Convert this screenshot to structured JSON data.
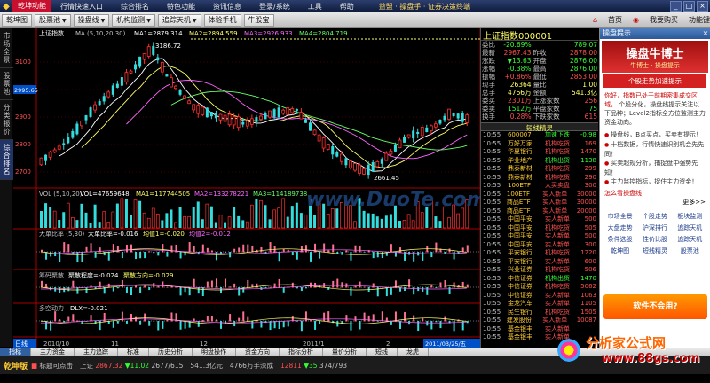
{
  "titlebar": {
    "menu": [
      "乾坤功能",
      "行情快速入口",
      "综合排名",
      "特色功能",
      "资讯信息",
      "登录/系统",
      "工具",
      "帮助"
    ],
    "center": "益盟 · 操盘手 · 证券决策终端",
    "win_buttons": [
      "_",
      "□",
      "×"
    ]
  },
  "toolbar": {
    "buttons": [
      "乾坤图",
      "股票池",
      "操盘线",
      "机构监测",
      "追踪天机",
      "体验手机",
      "牛股宝"
    ],
    "right_items": [
      "首页",
      "我要购买",
      "功能键"
    ]
  },
  "leftstrip": [
    "市场全景",
    "股票池",
    "分类报价",
    "综合排名"
  ],
  "chart": {
    "main_header": {
      "name": "上证指数",
      "ma_label": "MA (5,10,20,30)",
      "ma1": "MA1=2879.314",
      "ma2": "MA2=2894.559",
      "ma3": "MA3=2926.933",
      "ma4": "MA4=2804.719"
    },
    "price_labels": [
      "3100",
      "3000",
      "2995.65",
      "2900",
      "2800",
      "2700"
    ],
    "high_label": "3186.72",
    "low_label": "2661.45",
    "vol_header": {
      "name": "VOL (5,10,20)",
      "vol": "VOL=47659648",
      "ma1": "MA1=117744505",
      "ma2": "MA2=133278221",
      "ma3": "MA3=114189738"
    },
    "sub1_header": {
      "name": "大单比率 (5,30)",
      "v1": "大单比率=-0.016",
      "v2": "均值1=-0.020",
      "v3": "均值2=-0.012"
    },
    "sub2_header": {
      "name": "筹码聚散",
      "v1": "聚散程度=-0.024",
      "v2": "聚散方向=-0.029"
    },
    "sub3_header": {
      "name": "多空动力",
      "v1": "DLX=-0.021"
    },
    "date_labels": [
      "2010/10",
      "11",
      "12",
      "2011/1",
      "2",
      "2011/03/25/五"
    ],
    "day_label": "日线",
    "watermark": "www.DuoTe.com"
  },
  "quote": {
    "title": "上证指数",
    "code": "000001",
    "rows": [
      {
        "l": "委比",
        "v": "-20.69%",
        "l2": "",
        "v2": "789.07",
        "c": "g"
      },
      {
        "l": "最新",
        "v": "2967.43",
        "l2": "昨收",
        "v2": "2878.00",
        "c": "v"
      },
      {
        "l": "涨跌",
        "v": "▼13.63",
        "l2": "开盘",
        "v2": "2876.00",
        "c": "g"
      },
      {
        "l": "涨幅",
        "v": "-0.38%",
        "l2": "最高",
        "v2": "2876.00",
        "c": "g"
      },
      {
        "l": "振幅",
        "v": "+0.86%",
        "l2": "最低",
        "v2": "2853.00",
        "c": "v"
      },
      {
        "l": "现手",
        "v": "26364",
        "l2": "量比",
        "v2": "1.00",
        "c": "y"
      },
      {
        "l": "总手",
        "v": "4766万",
        "l2": "金额",
        "v2": "541.3亿",
        "c": "y"
      },
      {
        "l": "委买",
        "v": "2301万",
        "l2": "上涨家数",
        "v2": "256",
        "c": "v"
      },
      {
        "l": "委卖",
        "v": "1512万",
        "l2": "平盘家数",
        "v2": "75",
        "c": "g"
      },
      {
        "l": "换手",
        "v": "0.28%",
        "l2": "下跌家数",
        "v2": "615",
        "c": "v"
      }
    ],
    "section": "短线精灵",
    "news": [
      {
        "t": "10:55",
        "c": "600007",
        "d": "加速下跌",
        "n": "-0.98",
        "dn": true
      },
      {
        "t": "10:55",
        "c": "万好万家",
        "d": "机构吃货",
        "n": "169",
        "dn": false
      },
      {
        "t": "10:55",
        "c": "华夏银行",
        "d": "机构吃货",
        "n": "1470",
        "dn": false
      },
      {
        "t": "10:55",
        "c": "华业地产",
        "d": "机构出货",
        "n": "1138",
        "dn": true
      },
      {
        "t": "10:55",
        "c": "鼎泰新材",
        "d": "机构吃货",
        "n": "299",
        "dn": false
      },
      {
        "t": "10:55",
        "c": "鼎泰新材",
        "d": "机构吃货",
        "n": "290",
        "dn": false
      },
      {
        "t": "10:55",
        "c": "100ETF",
        "d": "大买卖盘",
        "n": "300",
        "dn": false
      },
      {
        "t": "10:55",
        "c": "100ETF",
        "d": "实人新单",
        "n": "30000",
        "dn": false
      },
      {
        "t": "10:55",
        "c": "商品ETF",
        "d": "实人新单",
        "n": "30000",
        "dn": false
      },
      {
        "t": "10:55",
        "c": "商品ETF",
        "d": "实人新单",
        "n": "20000",
        "dn": false
      },
      {
        "t": "10:55",
        "c": "中国平安",
        "d": "实人新单",
        "n": "500",
        "dn": false
      },
      {
        "t": "10:55",
        "c": "中国平安",
        "d": "机构吃货",
        "n": "505",
        "dn": false
      },
      {
        "t": "10:55",
        "c": "中国平安",
        "d": "实人新单",
        "n": "500",
        "dn": false
      },
      {
        "t": "10:55",
        "c": "中国平安",
        "d": "实人新单",
        "n": "300",
        "dn": false
      },
      {
        "t": "10:55",
        "c": "平安银行",
        "d": "机构吃货",
        "n": "1220",
        "dn": false
      },
      {
        "t": "10:55",
        "c": "平安银行",
        "d": "实人新单",
        "n": "600",
        "dn": false
      },
      {
        "t": "10:55",
        "c": "兴业证券",
        "d": "机构吃货",
        "n": "506",
        "dn": false
      },
      {
        "t": "10:55",
        "c": "中信证券",
        "d": "机构出货",
        "n": "1470",
        "dn": true
      },
      {
        "t": "10:55",
        "c": "中信证券",
        "d": "机构吃货",
        "n": "5062",
        "dn": false
      },
      {
        "t": "10:55",
        "c": "中信证券",
        "d": "实人新单",
        "n": "1063",
        "dn": false
      },
      {
        "t": "10:55",
        "c": "金龙汽车",
        "d": "实人新单",
        "n": "1105",
        "dn": false
      },
      {
        "t": "10:55",
        "c": "民生银行",
        "d": "机构吃货",
        "n": "1505",
        "dn": false
      },
      {
        "t": "10:55",
        "c": "建发股份",
        "d": "实人新单",
        "n": "10087",
        "dn": false
      },
      {
        "t": "10:55",
        "c": "基金银丰",
        "d": "实人新单",
        "n": "",
        "dn": false
      },
      {
        "t": "10:55",
        "c": "基金银丰",
        "d": "实人新单",
        "n": "",
        "dn": false
      }
    ]
  },
  "right": {
    "header": "操盘提示",
    "logo_main": "操盘牛博士",
    "logo_sub": "牛博士 · 操盘提示",
    "banner": "个股走势加速提示",
    "para1": "你好，指数已处于前期密集成交区域，",
    "para2": "个股分化，操盘线提示关注以下品种；Level2指标全方位监测主力资金动向。",
    "items": [
      "操盘线，B点买点，买卖有提示！",
      "十档数据，行情快速识别机会先先同！",
      "买卖超规分析，捕捉盘中强势先知！",
      "主力监控指标，捉住主力资金！"
    ],
    "more": "更多>>",
    "how": "怎么看操盘线",
    "links": [
      "市场全景",
      "个股走势",
      "板块监测",
      "大盘走势",
      "沪深排行",
      "追踪天机",
      "条件选股",
      "性价比股",
      "追踪天机",
      "乾坤图",
      "短线精灵",
      "股票池"
    ],
    "ad": "软件不会用?"
  },
  "bottombar": {
    "tabs": [
      "指标",
      "主力资金",
      "主力追踪",
      "标准",
      "历史分析",
      "明盘操作",
      "资金方向",
      "指标分析",
      "量价分析",
      "短线",
      "龙虎"
    ],
    "active_tab": "指标",
    "brand": "乾坤版",
    "status": "标题可点击",
    "idx1_name": "上证",
    "idx1_val": "2867.32",
    "idx1_chg": "▼11.02",
    "idx1_pct": "2677/615",
    "idx2_val": "541.3亿元",
    "idx3_val": "4766万手深成",
    "idx4_val": "12811",
    "idx4_chg": "▼35",
    "idx4_pct": "374/793"
  },
  "watermark": {
    "w1": "分析家公式网",
    "w2": "www.88gs.com"
  }
}
